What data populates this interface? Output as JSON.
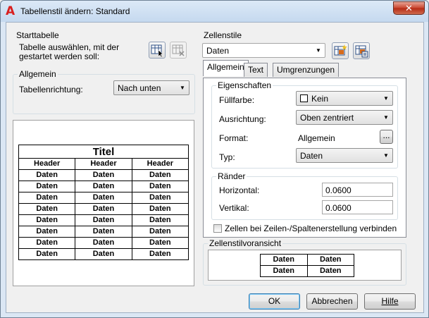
{
  "window": {
    "title": "Tabellenstil ändern: Standard",
    "close_glyph": "✕"
  },
  "starttabelle": {
    "title": "Starttabelle",
    "label_line1": "Tabelle auswählen, mit der",
    "label_line2": "gestartet werden soll:"
  },
  "allgemein": {
    "title": "Allgemein",
    "direction_label": "Tabellenrichtung:",
    "direction_value": "Nach unten"
  },
  "preview": {
    "title_text": "Titel",
    "headers": [
      "Header",
      "Header",
      "Header"
    ],
    "data_text": "Daten",
    "row_count": 8
  },
  "zellenstile": {
    "title": "Zellenstile",
    "value": "Daten"
  },
  "tabs": [
    "Allgemein",
    "Text",
    "Umgrenzungen"
  ],
  "eigenschaften": {
    "title": "Eigenschaften",
    "fill_label": "Füllfarbe:",
    "fill_value": "Kein",
    "align_label": "Ausrichtung:",
    "align_value": "Oben zentriert",
    "format_label": "Format:",
    "format_value": "Allgemein",
    "format_btn": "...",
    "type_label": "Typ:",
    "type_value": "Daten"
  },
  "raender": {
    "title": "Ränder",
    "horizontal_label": "Horizontal:",
    "horizontal_value": "0.0600",
    "vertical_label": "Vertikal:",
    "vertical_value": "0.0600"
  },
  "merge_checkbox": {
    "label": "Zellen bei Zeilen-/Spaltenerstellung verbinden",
    "checked": false
  },
  "zellenstilvoransicht": {
    "title": "Zellenstilvoransicht",
    "cell": "Daten"
  },
  "buttons": {
    "ok": "OK",
    "cancel": "Abbrechen",
    "help": "Hilfe"
  }
}
